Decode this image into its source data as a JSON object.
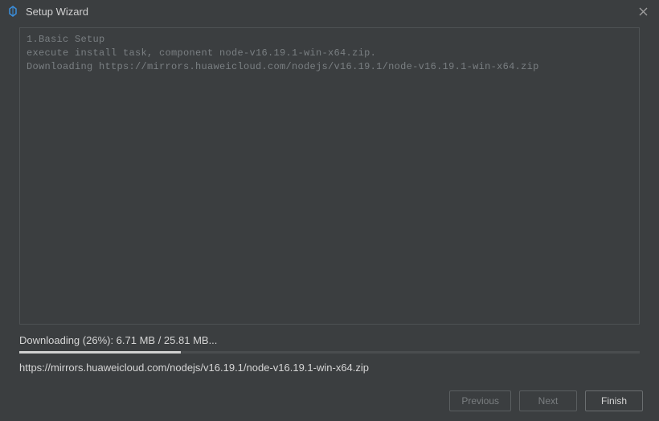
{
  "titlebar": {
    "title": "Setup Wizard"
  },
  "log": {
    "lines": [
      "1.Basic Setup",
      "execute install task, component node-v16.19.1-win-x64.zip.",
      "Downloading https://mirrors.huaweicloud.com/nodejs/v16.19.1/node-v16.19.1-win-x64.zip"
    ]
  },
  "status": {
    "text": "Downloading (26%): 6.71 MB / 25.81 MB...",
    "progress_percent": 26,
    "url": "https://mirrors.huaweicloud.com/nodejs/v16.19.1/node-v16.19.1-win-x64.zip"
  },
  "buttons": {
    "previous": "Previous",
    "next": "Next",
    "finish": "Finish"
  },
  "colors": {
    "background": "#3b3e40",
    "border": "#4e5254",
    "text_muted": "#7a7f82",
    "text_normal": "#d5d5d5"
  }
}
